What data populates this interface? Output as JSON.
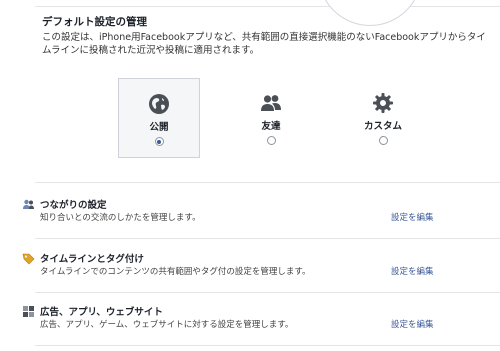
{
  "defaults": {
    "title": "デフォルト設定の管理",
    "description": "この設定は、iPhone用Facebookアプリなど、共有範囲の直接選択機能のないFacebookアプリからタイムラインに投稿された近況や投稿に適用されます。",
    "options": [
      {
        "label": "公開",
        "icon": "globe-icon",
        "selected": true
      },
      {
        "label": "友達",
        "icon": "friends-icon",
        "selected": false
      },
      {
        "label": "カスタム",
        "icon": "gear-icon",
        "selected": false
      }
    ]
  },
  "settings": [
    {
      "title": "つながりの設定",
      "description": "知り合いとの交流のしかたを管理します。",
      "link": "設定を編集",
      "icon": "connections-icon"
    },
    {
      "title": "タイムラインとタグ付け",
      "description": "タイムラインでのコンテンツの共有範囲やタグ付の設定を管理します。",
      "link": "設定を編集",
      "icon": "tag-icon"
    },
    {
      "title": "広告、アプリ、ウェブサイト",
      "description": "広告、アプリ、ゲーム、ウェブサイトに対する設定を管理します。",
      "link": "設定を編集",
      "icon": "apps-icon"
    }
  ],
  "colors": {
    "link": "#3b5998",
    "selected_bg": "#f5f6f7"
  }
}
